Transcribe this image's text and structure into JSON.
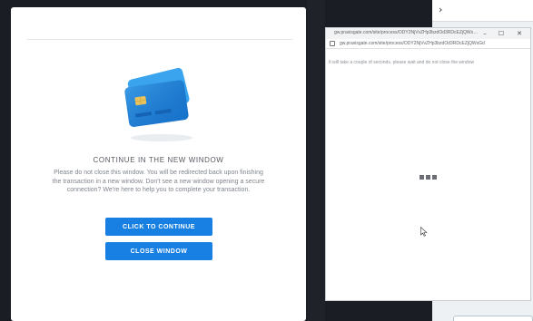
{
  "colors": {
    "primary_button": "#1780e2",
    "card_blue": "#1a78d2",
    "card_light_blue": "#3aa4ee",
    "chip_gold": "#e8c25c"
  },
  "modal": {
    "title": "CONTINUE IN THE NEW WINDOW",
    "body": "Please do not close this window. You will be redirected back upon finishing the transaction in a new window. Don't see a new window opening a secure connection? We're here to help you to complete your transaction.",
    "continue_button": "CLICK TO CONTINUE",
    "close_button": "CLOSE WINDOW",
    "illustration_icon": "credit-card-icon"
  },
  "popup": {
    "title": "gw.praxisgate.com/site/process/ODY2NjVvZHp3bzdOd3RDcEZjQWxGd...",
    "window_controls": {
      "minimize": "–",
      "maximize": "☐",
      "close": "✕"
    },
    "address": "gw.praxisgate.com/site/process/ODY2NjVvZHp3bzdOd3RDcEZjQWxGd",
    "message": "It will take a couple of seconds, please wait and do not close the window",
    "loading_icon": "loading-dots-icon"
  },
  "backdrop": {
    "chevron": "›"
  }
}
